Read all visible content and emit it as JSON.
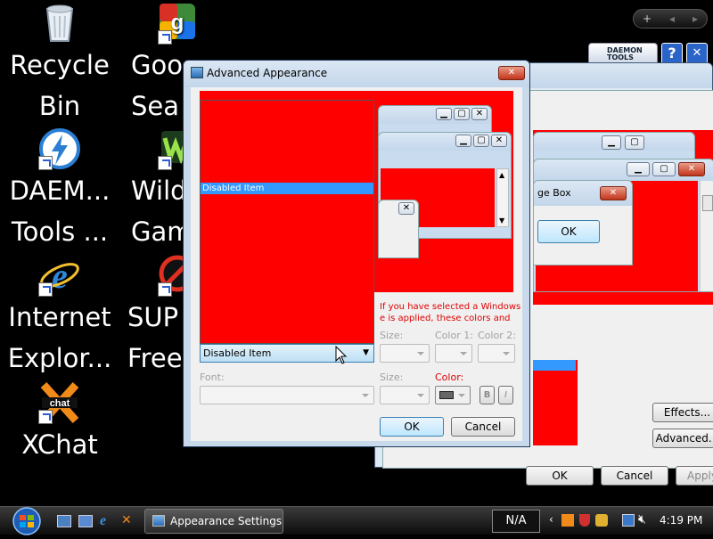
{
  "desktop": {
    "icons": [
      {
        "name": "recycle-bin",
        "line1": "Recycle",
        "line2": "Bin"
      },
      {
        "name": "google-search",
        "line1": "Goo",
        "line2": "Sea"
      },
      {
        "name": "daemon-tools",
        "line1": "DAEM...",
        "line2": "Tools ..."
      },
      {
        "name": "wild-games",
        "line1": "Wild",
        "line2": "Gam"
      },
      {
        "name": "internet-explorer",
        "line1": "Internet",
        "line2": "Explor..."
      },
      {
        "name": "super-free",
        "line1": "SUP",
        "line2": "Free"
      },
      {
        "name": "xchat",
        "line1": "",
        "line2": "XChat"
      }
    ],
    "gadget": {
      "add": "+",
      "prev": "◂",
      "next": "▸"
    },
    "daemon_bar": {
      "label": "DAEMON TOOLS",
      "help": "?",
      "close": "✕"
    }
  },
  "background_window": {
    "inner_title": "ge Box",
    "ok": "OK",
    "effects": "Effects...",
    "advanced": "Advanced...",
    "footer_ok": "OK",
    "footer_cancel": "Cancel",
    "footer_apply": "Apply"
  },
  "dialog": {
    "title": "Advanced Appearance",
    "list_item": "Disabled Item",
    "note_line1": "If you have selected a Windows",
    "note_line2": "e is applied, these colors and",
    "item_selected": "Disabled Item",
    "labels": {
      "size": "Size:",
      "color1": "Color 1:",
      "color2": "Color 2:",
      "font": "Font:",
      "font_size": "Size:",
      "font_color": "Color:"
    },
    "bold": "B",
    "italic": "I",
    "ok": "OK",
    "cancel": "Cancel"
  },
  "taskbar": {
    "task": "Appearance Settings",
    "language": "N/A",
    "time": "4:19 PM"
  },
  "colors": {
    "accent_red": "#ff0000",
    "selection": "#3399ff",
    "taskbar": "#1b1b1b"
  }
}
